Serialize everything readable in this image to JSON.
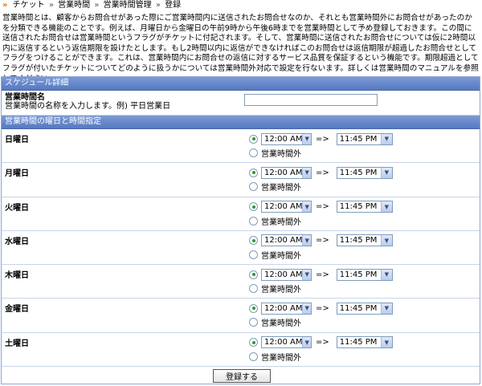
{
  "breadcrumb": [
    "チケット",
    "営業時間",
    "営業時間管理",
    "登録"
  ],
  "description": "営業時間とは、顧客からお問合せがあった際にご営業時間内に送信されたお問合せなのか、それとも営業時間外にお問合せがあったのかを分類できる機能のことです。例えば、月曜日から金曜日の午前9時から午後6時までを営業時間として予め登録しておきます。この間に送信されたお問合せは営業時間というフラグがチケットに付記されます。そして、営業時間に送信されたお問合せについては仮に2時間以内に返信するという返信期限を設けたとします。もし2時間以内に返信ができなければこのお問合せは返信期限が超過したお問合せとしてフラグをつけることができます。これは、営業時間内にお問合せの返信に対するサービス品質を保証するという機能です。期限超過としてフラグが付いたチケットについてどのように扱うかについては営業時間外対応で設定を行ないます。詳しくは営業時間のマニュアルを参照してください。",
  "schedule_section": "スケジュール詳細",
  "name_label": "営業時間名",
  "name_help": "営業時間の名称を入力します。例) 平日営業日",
  "name_value": "",
  "days_section": "営業時間の曜日と時間指定",
  "arrow": "=>",
  "outside_label": "営業時間外",
  "days": [
    {
      "name": "日曜日",
      "start": "12:00 AM",
      "end": "11:45 PM"
    },
    {
      "name": "月曜日",
      "start": "12:00 AM",
      "end": "11:45 PM"
    },
    {
      "name": "火曜日",
      "start": "12:00 AM",
      "end": "11:45 PM"
    },
    {
      "name": "水曜日",
      "start": "12:00 AM",
      "end": "11:45 PM"
    },
    {
      "name": "木曜日",
      "start": "12:00 AM",
      "end": "11:45 PM"
    },
    {
      "name": "金曜日",
      "start": "12:00 AM",
      "end": "11:45 PM"
    },
    {
      "name": "土曜日",
      "start": "12:00 AM",
      "end": "11:45 PM"
    }
  ],
  "submit_label": "登録する",
  "colors": {
    "section_bar": "#5f82c8",
    "radio_selected": "#2e9a2e",
    "breadcrumb_arrow": "#e07000"
  }
}
